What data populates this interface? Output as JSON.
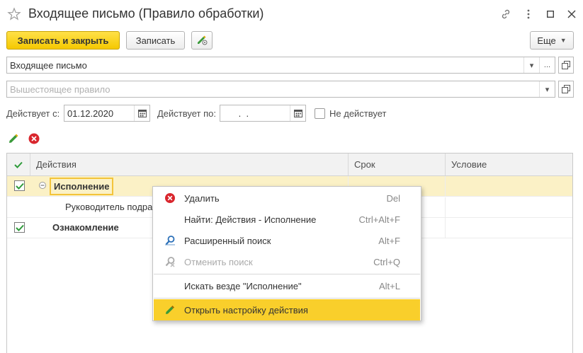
{
  "window": {
    "title": "Входящее письмо (Правило обработки)"
  },
  "toolbar": {
    "save_close_label": "Записать и закрыть",
    "save_label": "Записать",
    "more_label": "Еще"
  },
  "form": {
    "type_value": "Входящее письмо",
    "parent_placeholder": "Вышестоящее правило",
    "valid_from_label": "Действует с:",
    "valid_from_value": "01.12.2020",
    "valid_to_label": "Действует по:",
    "valid_to_value": " .  .",
    "inactive_label": "Не действует"
  },
  "table": {
    "columns": [
      "Действия",
      "Срок",
      "Условие"
    ],
    "rows": [
      {
        "text": "Исполнение",
        "checked": true,
        "selected": true
      },
      {
        "text": "Руководитель подра",
        "checked": false
      },
      {
        "text": "Ознакомление",
        "checked": true
      }
    ]
  },
  "context_menu": {
    "items": [
      {
        "label": "Удалить",
        "shortcut": "Del",
        "icon": "delete-icon"
      },
      {
        "label": "Найти: Действия - Исполнение",
        "shortcut": "Ctrl+Alt+F",
        "icon": ""
      },
      {
        "label": "Расширенный поиск",
        "shortcut": "Alt+F",
        "icon": "search-icon"
      },
      {
        "label": "Отменить поиск",
        "shortcut": "Ctrl+Q",
        "icon": "cancel-search-icon",
        "disabled": true
      },
      {
        "label": "Искать везде \"Исполнение\"",
        "shortcut": "Alt+L",
        "icon": ""
      },
      {
        "label": "Открыть настройку действия",
        "shortcut": "",
        "icon": "pencil-icon",
        "active": true
      }
    ]
  },
  "colors": {
    "primary": "#f5c800",
    "selection": "#fbf1c6",
    "menu_active": "#f9cf2b",
    "delete_red": "#d9262d",
    "check_green": "#2e9b3a"
  }
}
